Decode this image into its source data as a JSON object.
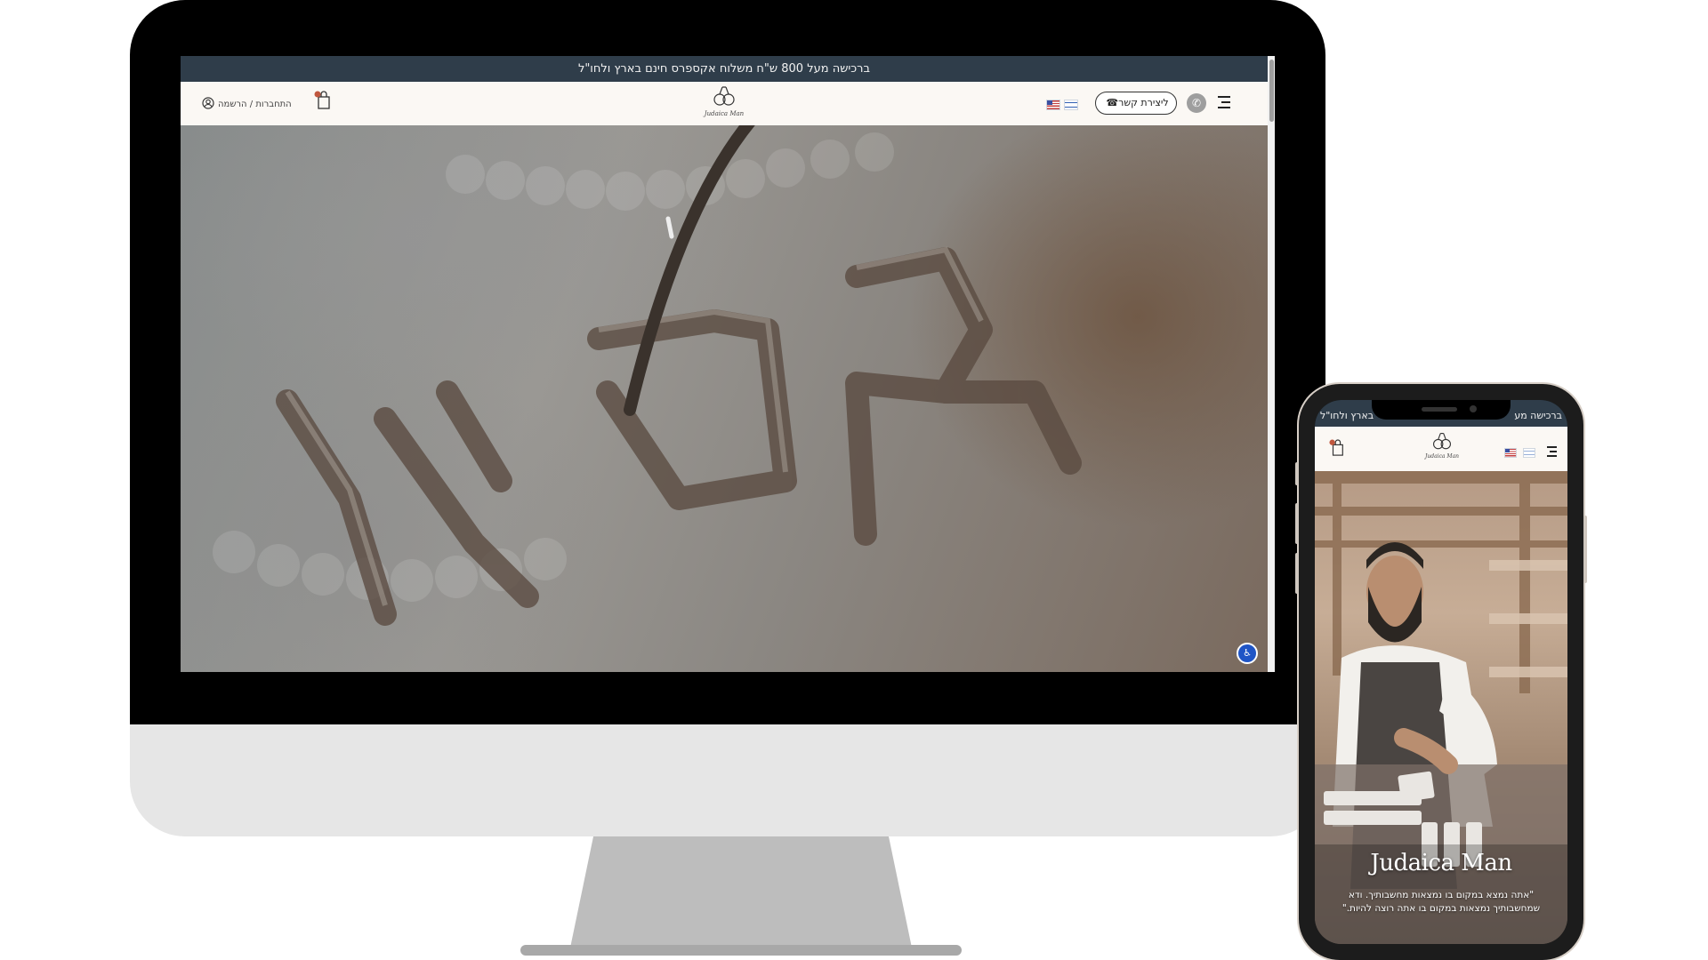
{
  "desktop": {
    "announcement": "ברכישה מעל 800 ש\"ח משלוח אקספרס חינם בארץ ולחו\"ל",
    "header": {
      "contact_label": "ליצירת קשר",
      "login_label": "התחברות",
      "separator": "/",
      "register_label": "הרשמה",
      "logo_text": "Judaica Man",
      "accessibility_glyph": "♿"
    }
  },
  "mobile": {
    "announcement_left": "בארץ ולחו\"ל",
    "announcement_right": "ברכישה מע",
    "logo_text": "Judaica Man",
    "hero_title": "Judaica Man",
    "hero_quote": "\"אתה נמצא במקום בו נמצאות מחשבותיך. ודא שמחשבותיך נמצאות במקום בו אתה רוצה להיות.\"",
    "accessibility_glyph": "♿"
  },
  "colors": {
    "announcement_bg": "#2f3d4a",
    "header_bg": "#fbf8f4",
    "accessibility_blue": "#1f55c6",
    "monitor_bezel": "#000000",
    "monitor_chin": "#e6e6e6"
  },
  "icons": [
    "hamburger-icon",
    "whatsapp-icon",
    "phone-icon",
    "us-flag-icon",
    "israel-flag-icon",
    "cart-icon",
    "user-icon",
    "accessibility-icon"
  ]
}
